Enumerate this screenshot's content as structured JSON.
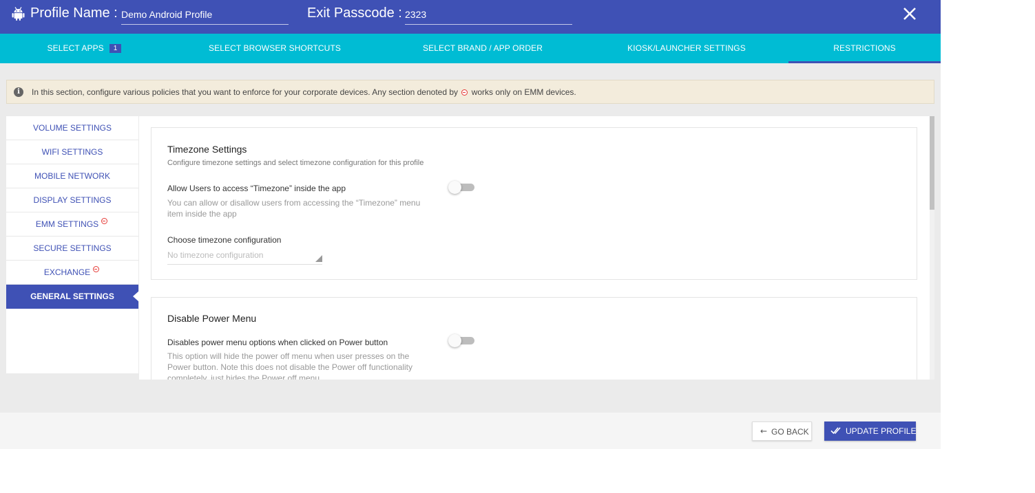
{
  "header": {
    "profile_name_label": "Profile Name :",
    "profile_name_value": "Demo Android Profile",
    "exit_passcode_label": "Exit Passcode :",
    "exit_passcode_value": "2323",
    "close_icon": "close-icon",
    "app_icon": "android-icon"
  },
  "tabs": [
    {
      "label": "SELECT APPS",
      "badge": "1"
    },
    {
      "label": "SELECT BROWSER SHORTCUTS"
    },
    {
      "label": "SELECT BRAND / APP ORDER"
    },
    {
      "label": "KIOSK/LAUNCHER SETTINGS"
    },
    {
      "label": "RESTRICTIONS",
      "active": true
    }
  ],
  "info": {
    "text_before": "In this section, configure various policies that you want to enforce for your corporate devices. Any section denoted by",
    "text_after": "works only on EMM devices."
  },
  "sidebar": {
    "items": [
      {
        "label": "VOLUME SETTINGS"
      },
      {
        "label": "WIFI SETTINGS"
      },
      {
        "label": "MOBILE NETWORK"
      },
      {
        "label": "DISPLAY SETTINGS"
      },
      {
        "label": "EMM SETTINGS",
        "emm": true
      },
      {
        "label": "SECURE SETTINGS"
      },
      {
        "label": "EXCHANGE",
        "emm": true
      },
      {
        "label": "GENERAL SETTINGS",
        "active": true
      }
    ]
  },
  "timezone": {
    "title": "Timezone Settings",
    "subtitle": "Configure timezone settings and select timezone configuration for this profile",
    "allow_label": "Allow Users to access “Timezone” inside the app",
    "allow_desc": "You can allow or disallow users from accessing the “Timezone” menu item inside the app",
    "allow_enabled": false,
    "config_label": "Choose timezone configuration",
    "config_value": "No timezone configuration"
  },
  "power_menu": {
    "title": "Disable Power Menu",
    "option_label": "Disables power menu options when clicked on Power button",
    "option_desc": "This option will hide the power off menu when user presses on the Power button. Note this does not disable the Power off functionality completely, just hides the Power off menu",
    "enabled": false
  },
  "footer": {
    "back_label": "GO BACK",
    "update_label": "UPDATE PROFILE"
  },
  "colors": {
    "primary": "#3f51b5",
    "tab_bar": "#00bcd4",
    "emm_marker": "#e53935",
    "info_bg": "#f3ecdc"
  }
}
